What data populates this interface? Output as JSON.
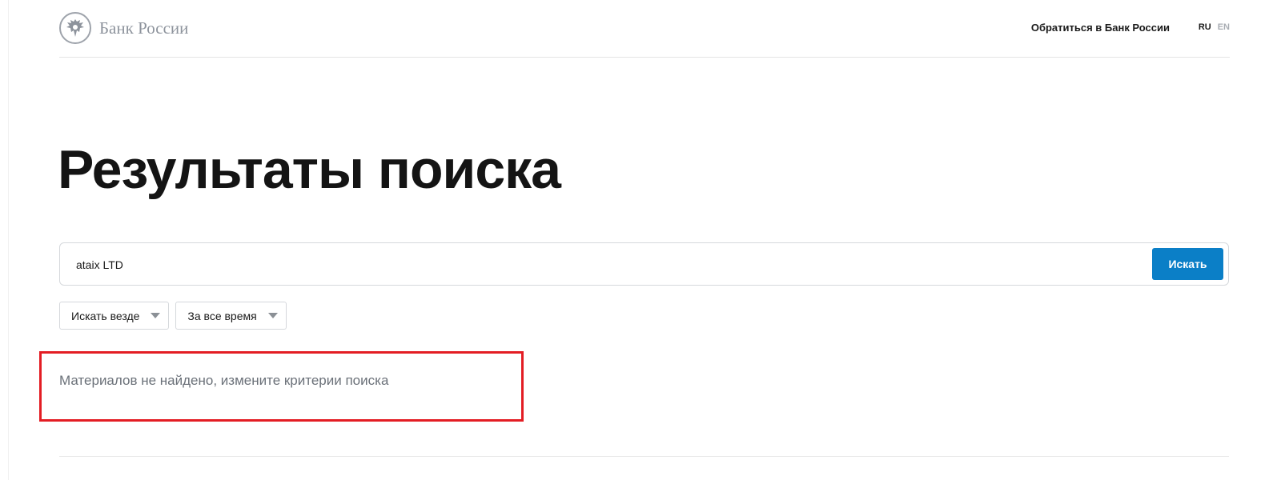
{
  "header": {
    "logo_text": "Банк России",
    "logo_icon": "double-headed-eagle-icon",
    "contact_link": "Обратиться в Банк России",
    "languages": [
      "RU",
      "EN"
    ],
    "active_language": "RU"
  },
  "page": {
    "title": "Результаты поиска"
  },
  "search": {
    "value": "ataix LTD",
    "button_label": "Искать"
  },
  "filters": {
    "scope": "Искать везде",
    "period": "За все время"
  },
  "results": {
    "message": "Материалов не найдено, измените критерии поиска"
  },
  "colors": {
    "accent": "#0b7fc7",
    "highlight": "#e31d24",
    "muted_text": "#6b7179"
  }
}
